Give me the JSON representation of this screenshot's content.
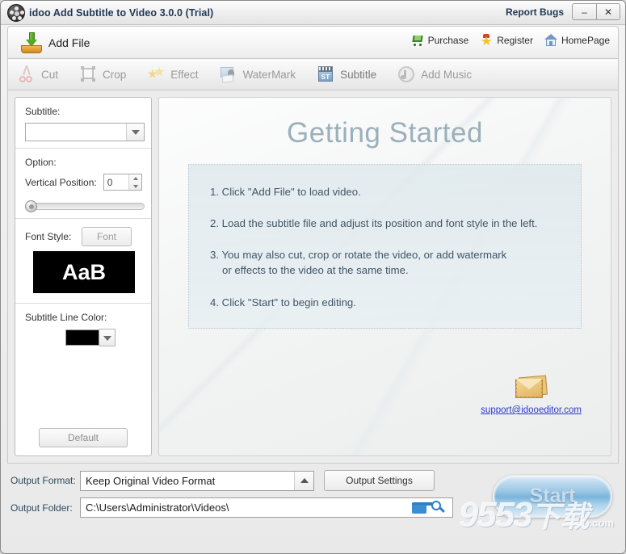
{
  "window": {
    "title": "idoo Add Subtitle to Video 3.0.0 (Trial)",
    "app_icon": "film-reel-icon",
    "report_bugs": "Report Bugs",
    "minimize": "–",
    "close": "✕"
  },
  "addfile": {
    "label": "Add File",
    "icon": "download-arrow-icon"
  },
  "quicklinks": [
    {
      "label": "Purchase",
      "icon": "shopping-cart-icon"
    },
    {
      "label": "Register",
      "icon": "star-badge-icon"
    },
    {
      "label": "HomePage",
      "icon": "home-icon"
    }
  ],
  "tabs": [
    {
      "label": "Cut",
      "icon": "scissors-icon",
      "active": false
    },
    {
      "label": "Crop",
      "icon": "crop-icon",
      "active": false
    },
    {
      "label": "Effect",
      "icon": "stars-icon",
      "active": false
    },
    {
      "label": "WaterMark",
      "icon": "watermark-icon",
      "active": false
    },
    {
      "label": "Subtitle",
      "icon": "clapperboard-st-icon",
      "active": true
    },
    {
      "label": "Add Music",
      "icon": "music-disc-icon",
      "active": false
    }
  ],
  "sidebar": {
    "subtitle_label": "Subtitle:",
    "subtitle_value": "",
    "option_label": "Option:",
    "vertical_position_label": "Vertical Position:",
    "vertical_position_value": "0",
    "slider_value": 0,
    "font_style_label": "Font Style:",
    "font_button": "Font",
    "font_preview_text": "AaB",
    "font_preview_bg": "#000000",
    "font_preview_fg": "#ffffff",
    "line_color_label": "Subtitle Line Color:",
    "line_color_value": "#000000",
    "default_button": "Default"
  },
  "main": {
    "title": "Getting Started",
    "steps": [
      {
        "num": "1.",
        "line1": "Click \"Add File\" to load video.",
        "line2": ""
      },
      {
        "num": "2.",
        "line1": "Load the subtitle file and adjust its position and font style in the left.",
        "line2": ""
      },
      {
        "num": "3.",
        "line1": "You may also cut, crop or rotate the video, or add watermark",
        "line2": "or effects to the video at the same time."
      },
      {
        "num": "4.",
        "line1": "Click \"Start\" to begin editing.",
        "line2": ""
      }
    ],
    "support_email": "support@idooeditor.com",
    "support_icon": "envelope-icon"
  },
  "footer": {
    "output_format_label": "Output Format:",
    "output_format_value": "Keep Original Video Format",
    "output_settings_button": "Output Settings",
    "output_folder_label": "Output Folder:",
    "output_folder_value": "C:\\Users\\Administrator\\Videos\\",
    "browse_icon": "folder-icon",
    "search_icon": "search-icon",
    "start_button": "Start"
  },
  "watermark": {
    "digits": "9553",
    "cn": "下载",
    "domain": ".com"
  },
  "colors": {
    "title_text": "#203a56",
    "link": "#2c38c8",
    "heading": "#9bb0bb",
    "step_text": "#3f5666",
    "accent_blue": "#2f7fc1"
  }
}
